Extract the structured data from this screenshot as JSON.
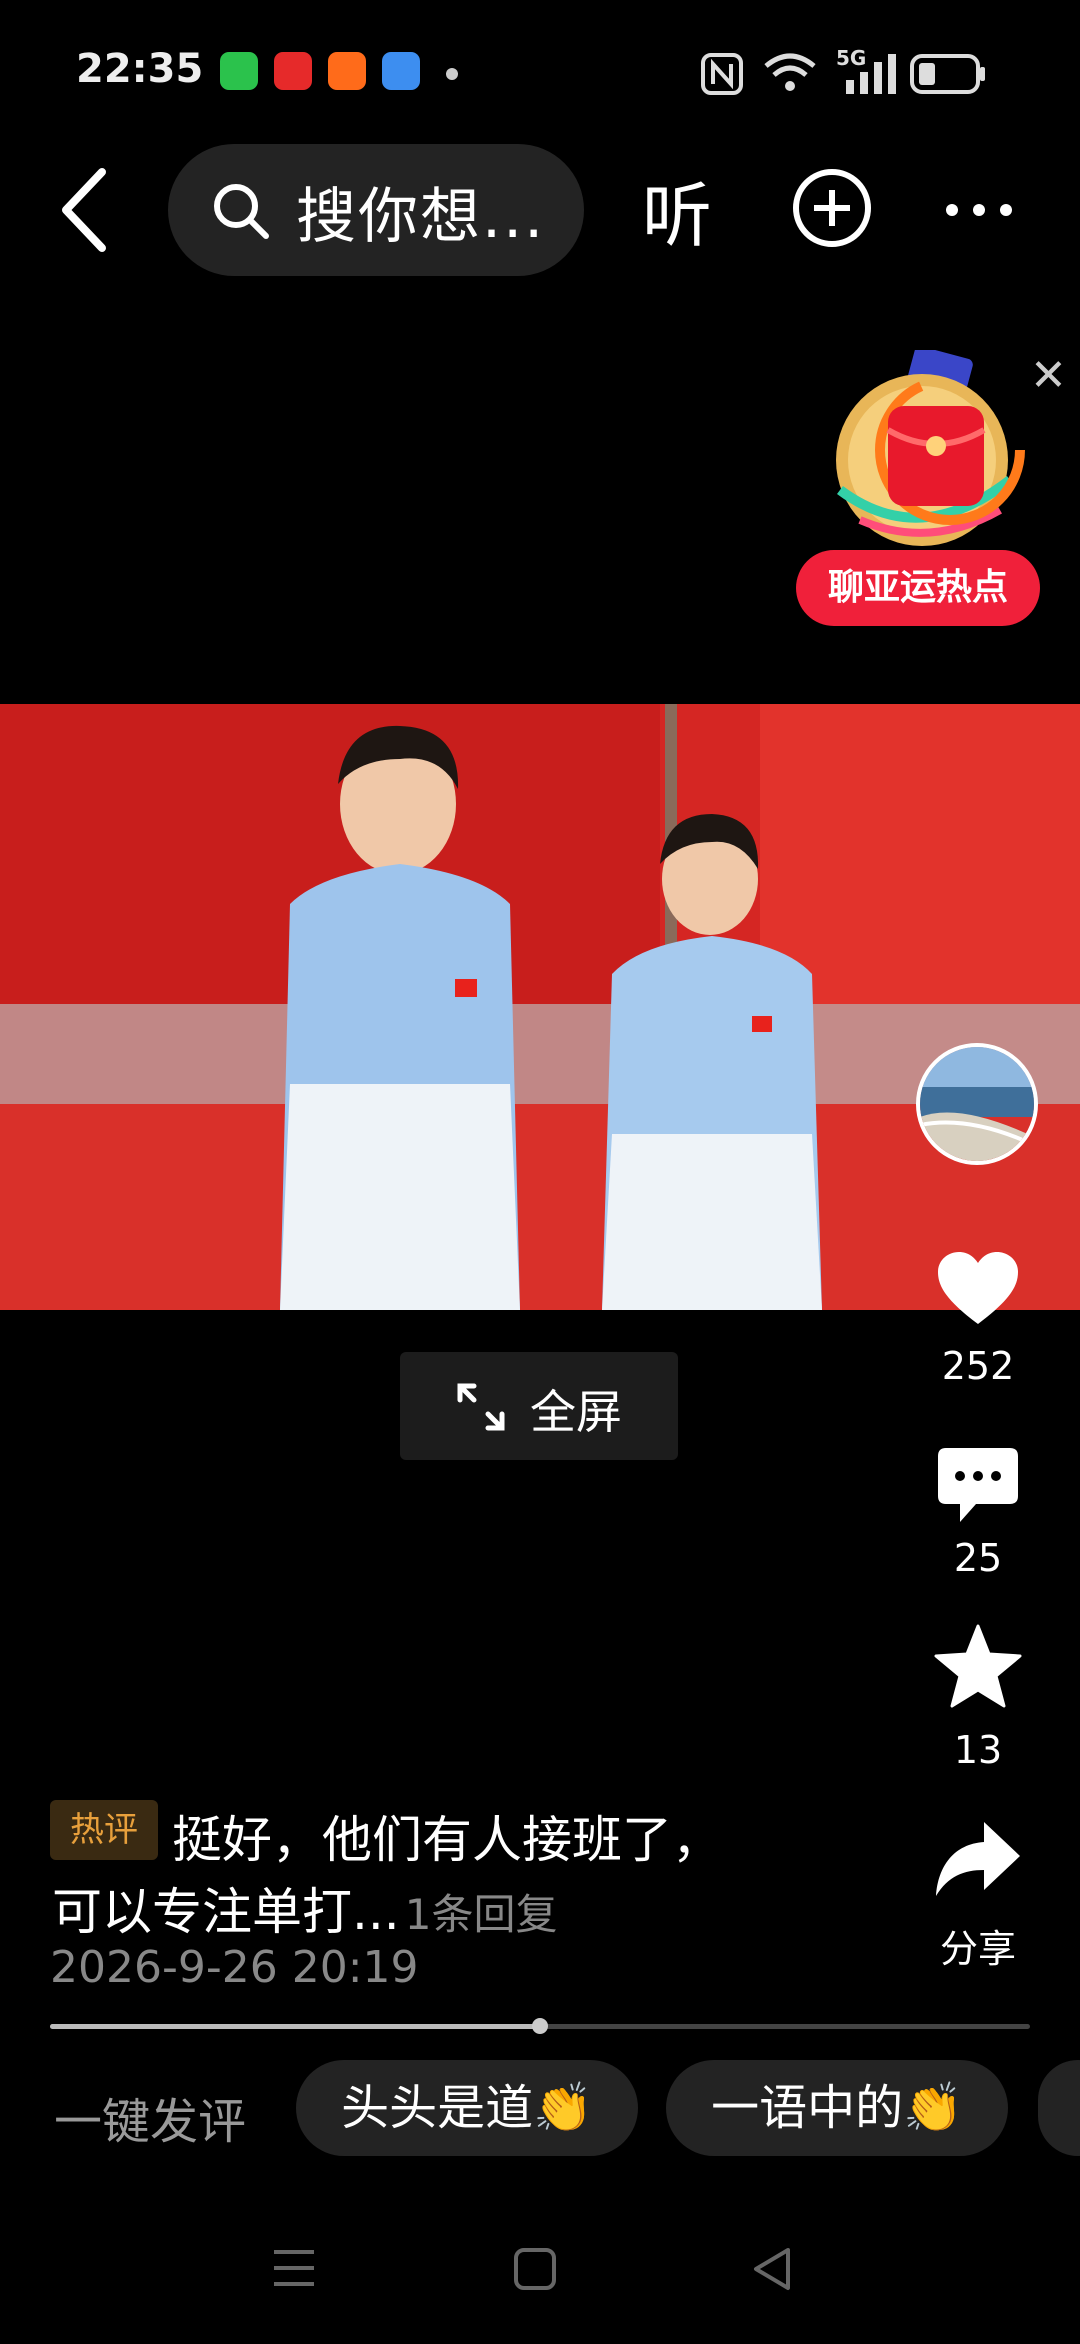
{
  "status_bar": {
    "time": "22:35",
    "network": "5G",
    "icons": [
      "wechat-icon",
      "toutiao-icon",
      "app-icon",
      "weather-icon",
      "nfc-icon",
      "wifi-icon",
      "signal-icon",
      "battery-icon"
    ]
  },
  "top_bar": {
    "search_placeholder": "搜你想...",
    "listen_label": "听"
  },
  "promo": {
    "badge_label": "聊亚运热点"
  },
  "video": {
    "fullscreen_label": "全屏"
  },
  "actions": {
    "likes": "252",
    "comments": "25",
    "favorites": "13",
    "share_label": "分享"
  },
  "comment": {
    "tag": "热评",
    "line1": "挺好，他们有人接班了，",
    "line2": "可以专注单打...",
    "reply_count": "1条回复",
    "time": "2026-9-26 20:19",
    "progress": 0.5
  },
  "quick_reply": {
    "label": "一键发评",
    "chips": [
      "头头是道👏",
      "一语中的👏"
    ]
  },
  "colors": {
    "accent_red": "#f0203a",
    "tag_text": "#e8a03c",
    "chip_bg": "#232323"
  }
}
